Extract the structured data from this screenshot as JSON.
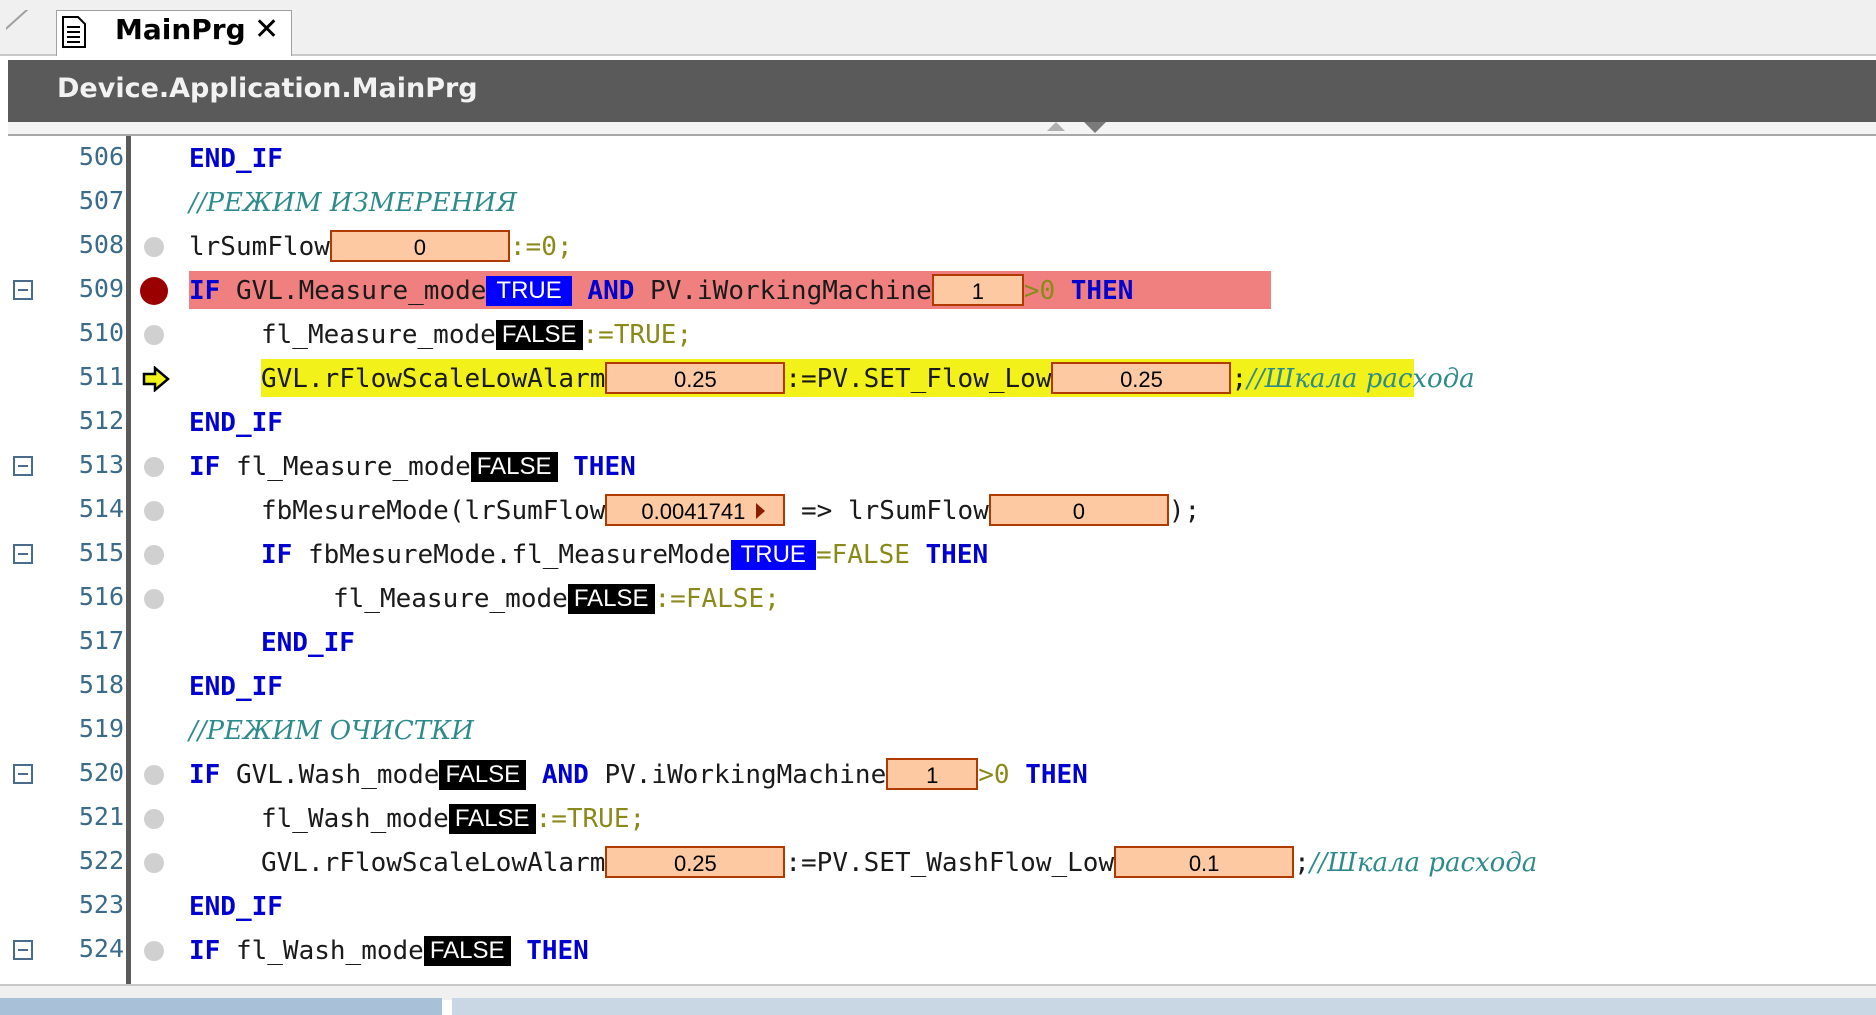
{
  "tab": {
    "title": "MainPrg",
    "close_glyph": "✕",
    "icon": "document-icon"
  },
  "path": "Device.Application.MainPrg",
  "colors": {
    "keyword": "#0000d0",
    "comment": "#2e8b8b",
    "breakpoint_line": "#f08080",
    "current_line": "#f2f21a",
    "inline_value_bg": "#fcc9a2",
    "inline_value_border": "#b03a00",
    "true_badge": "#0000ff",
    "false_badge": "#000000"
  },
  "lines": [
    {
      "num": "506",
      "fold": false,
      "marker": "none",
      "indent": 0,
      "tokens": [
        {
          "t": "kw",
          "v": "END_IF"
        }
      ]
    },
    {
      "num": "507",
      "fold": false,
      "marker": "none",
      "indent": 0,
      "tokens": [
        {
          "t": "cm",
          "v": "//РЕЖИМ ИЗМЕРЕНИЯ"
        }
      ]
    },
    {
      "num": "508",
      "fold": false,
      "marker": "dot",
      "indent": 0,
      "tokens": [
        {
          "t": "txt",
          "v": "lrSumFlow"
        },
        {
          "t": "iv",
          "v": "0",
          "w": 180
        },
        {
          "t": "lit",
          "v": ":=0;"
        }
      ]
    },
    {
      "num": "509",
      "fold": true,
      "marker": "breakpoint",
      "indent": 0,
      "highlight": "red",
      "tokens": [
        {
          "t": "kw",
          "v": "IF "
        },
        {
          "t": "txt",
          "v": "GVL.Measure_mode"
        },
        {
          "t": "bt",
          "v": "TRUE"
        },
        {
          "t": "txt",
          "v": " "
        },
        {
          "t": "kw",
          "v": "AND "
        },
        {
          "t": "txt",
          "v": "PV.iWorkingMachine"
        },
        {
          "t": "iv",
          "v": "1",
          "w": 92
        },
        {
          "t": "lit",
          "v": ">0 "
        },
        {
          "t": "kw",
          "v": "THEN"
        }
      ]
    },
    {
      "num": "510",
      "fold": false,
      "marker": "dot",
      "indent": 1,
      "tokens": [
        {
          "t": "txt",
          "v": "fl_Measure_mode"
        },
        {
          "t": "bf",
          "v": "FALSE"
        },
        {
          "t": "lit",
          "v": ":=TRUE;"
        }
      ]
    },
    {
      "num": "511",
      "fold": false,
      "marker": "current",
      "indent": 1,
      "highlight": "yellow",
      "tokens": [
        {
          "t": "txt",
          "v": "GVL.rFlowScaleLowAlarm"
        },
        {
          "t": "iv",
          "v": "0.25",
          "w": 180
        },
        {
          "t": "txt",
          "v": ":=PV.SET_Flow_Low"
        },
        {
          "t": "iv",
          "v": "0.25",
          "w": 180
        },
        {
          "t": "txt",
          "v": ";"
        },
        {
          "t": "cm",
          "v": "//Шкала расхода"
        }
      ]
    },
    {
      "num": "512",
      "fold": false,
      "marker": "none",
      "indent": 0,
      "tokens": [
        {
          "t": "kw",
          "v": "END_IF"
        }
      ]
    },
    {
      "num": "513",
      "fold": true,
      "marker": "dot",
      "indent": 0,
      "tokens": [
        {
          "t": "kw",
          "v": "IF "
        },
        {
          "t": "txt",
          "v": "fl_Measure_mode"
        },
        {
          "t": "bf",
          "v": "FALSE"
        },
        {
          "t": "txt",
          "v": " "
        },
        {
          "t": "kw",
          "v": "THEN"
        }
      ]
    },
    {
      "num": "514",
      "fold": false,
      "marker": "dot",
      "indent": 1,
      "tokens": [
        {
          "t": "txt",
          "v": "fbMesureMode(lrSumFlow"
        },
        {
          "t": "iva",
          "v": "0.0041741",
          "w": 180
        },
        {
          "t": "txt",
          "v": " => lrSumFlow"
        },
        {
          "t": "iv",
          "v": "0",
          "w": 180
        },
        {
          "t": "txt",
          "v": ");"
        }
      ]
    },
    {
      "num": "515",
      "fold": true,
      "marker": "dot",
      "indent": 1,
      "tokens": [
        {
          "t": "kw",
          "v": "IF "
        },
        {
          "t": "txt",
          "v": "fbMesureMode.fl_MeasureMode"
        },
        {
          "t": "bt",
          "v": "TRUE"
        },
        {
          "t": "lit",
          "v": "=FALSE "
        },
        {
          "t": "kw",
          "v": "THEN"
        }
      ]
    },
    {
      "num": "516",
      "fold": false,
      "marker": "dot",
      "indent": 2,
      "tokens": [
        {
          "t": "txt",
          "v": "fl_Measure_mode"
        },
        {
          "t": "bf",
          "v": "FALSE"
        },
        {
          "t": "lit",
          "v": ":=FALSE;"
        }
      ]
    },
    {
      "num": "517",
      "fold": false,
      "marker": "none",
      "indent": 1,
      "tokens": [
        {
          "t": "kw",
          "v": "END_IF"
        }
      ]
    },
    {
      "num": "518",
      "fold": false,
      "marker": "none",
      "indent": 0,
      "tokens": [
        {
          "t": "kw",
          "v": "END_IF"
        }
      ]
    },
    {
      "num": "519",
      "fold": false,
      "marker": "none",
      "indent": 0,
      "tokens": [
        {
          "t": "cm",
          "v": "//РЕЖИМ ОЧИСТКИ"
        }
      ]
    },
    {
      "num": "520",
      "fold": true,
      "marker": "dot",
      "indent": 0,
      "tokens": [
        {
          "t": "kw",
          "v": "IF "
        },
        {
          "t": "txt",
          "v": "GVL.Wash_mode"
        },
        {
          "t": "bf",
          "v": "FALSE"
        },
        {
          "t": "txt",
          "v": " "
        },
        {
          "t": "kw",
          "v": "AND "
        },
        {
          "t": "txt",
          "v": "PV.iWorkingMachine"
        },
        {
          "t": "iv",
          "v": "1",
          "w": 92
        },
        {
          "t": "lit",
          "v": ">0 "
        },
        {
          "t": "kw",
          "v": "THEN"
        }
      ]
    },
    {
      "num": "521",
      "fold": false,
      "marker": "dot",
      "indent": 1,
      "tokens": [
        {
          "t": "txt",
          "v": "fl_Wash_mode"
        },
        {
          "t": "bf",
          "v": "FALSE"
        },
        {
          "t": "lit",
          "v": ":=TRUE;"
        }
      ]
    },
    {
      "num": "522",
      "fold": false,
      "marker": "dot",
      "indent": 1,
      "tokens": [
        {
          "t": "txt",
          "v": "GVL.rFlowScaleLowAlarm"
        },
        {
          "t": "iv",
          "v": "0.25",
          "w": 180
        },
        {
          "t": "txt",
          "v": ":=PV.SET_WashFlow_Low"
        },
        {
          "t": "iv",
          "v": "0.1",
          "w": 180
        },
        {
          "t": "txt",
          "v": ";"
        },
        {
          "t": "cm",
          "v": "//Шкала расхода"
        }
      ]
    },
    {
      "num": "523",
      "fold": false,
      "marker": "none",
      "indent": 0,
      "tokens": [
        {
          "t": "kw",
          "v": "END_IF"
        }
      ]
    },
    {
      "num": "524",
      "fold": true,
      "marker": "dot",
      "indent": 0,
      "tokens": [
        {
          "t": "kw",
          "v": "IF "
        },
        {
          "t": "txt",
          "v": "fl_Wash_mode"
        },
        {
          "t": "bf",
          "v": "FALSE"
        },
        {
          "t": "txt",
          "v": " "
        },
        {
          "t": "kw",
          "v": "THEN"
        }
      ]
    }
  ]
}
